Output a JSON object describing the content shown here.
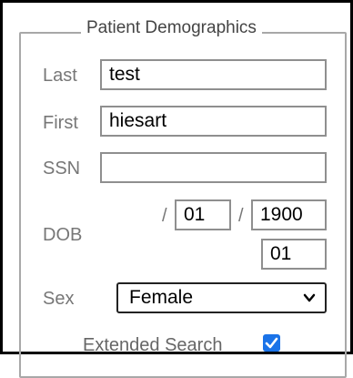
{
  "panel": {
    "title": "Patient Demographics"
  },
  "fields": {
    "last": {
      "label": "Last",
      "value": "test"
    },
    "first": {
      "label": "First",
      "value": "hiesart"
    },
    "ssn": {
      "label": "SSN",
      "value": ""
    },
    "dob": {
      "label": "DOB",
      "separator": "/",
      "month": "01",
      "year": "1900",
      "day": "01"
    },
    "sex": {
      "label": "Sex",
      "value": "Female"
    }
  },
  "extended_search": {
    "label": "Extended Search",
    "checked": true
  },
  "colors": {
    "checkbox_accent": "#1a73e8",
    "group_border": "#a8a8a8",
    "label_text": "#777777"
  }
}
